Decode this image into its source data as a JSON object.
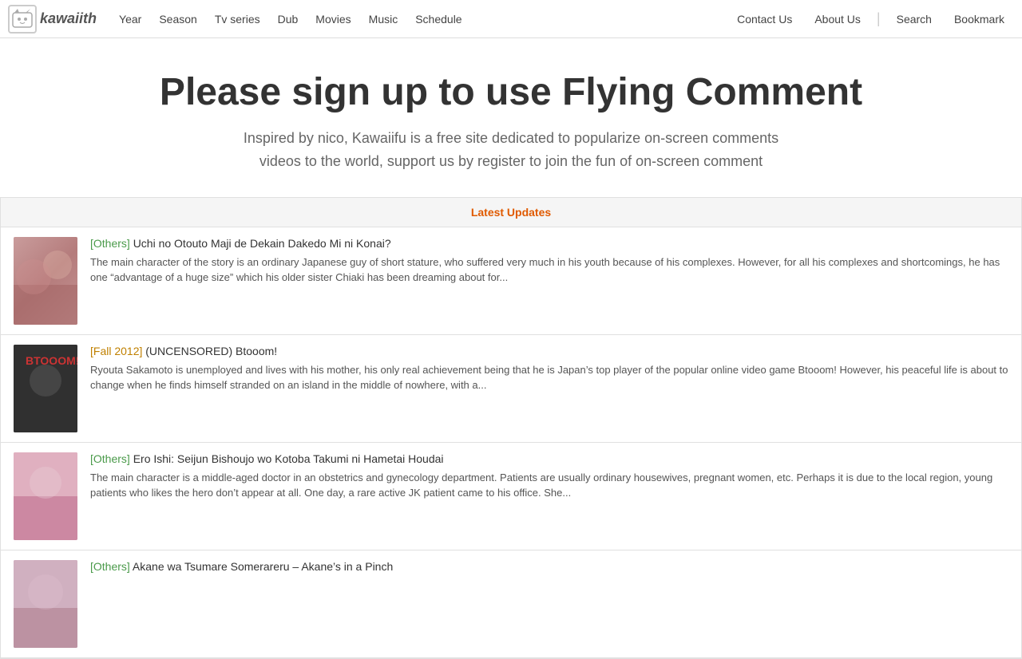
{
  "site": {
    "logo_emoji": "🐱",
    "logo_text": "kawaiith"
  },
  "navbar": {
    "links": [
      {
        "label": "Year",
        "id": "year"
      },
      {
        "label": "Season",
        "id": "season"
      },
      {
        "label": "Tv series",
        "id": "tv-series"
      },
      {
        "label": "Dub",
        "id": "dub"
      },
      {
        "label": "Movies",
        "id": "movies"
      },
      {
        "label": "Music",
        "id": "music"
      },
      {
        "label": "Schedule",
        "id": "schedule"
      }
    ],
    "right_links": [
      {
        "label": "Contact Us",
        "id": "contact"
      },
      {
        "label": "About Us",
        "id": "about"
      },
      {
        "label": "Search",
        "id": "search"
      },
      {
        "label": "Bookmark",
        "id": "bookmark"
      }
    ]
  },
  "hero": {
    "title": "Please sign up to use Flying Comment",
    "subtitle_line1": "Inspired by nico, Kawaiifu is a free site dedicated to popularize on-screen comments",
    "subtitle_line2": "videos to the world, support us by register to join the fun of on-screen comment"
  },
  "latest": {
    "header": "Latest Updates",
    "items": [
      {
        "tag": "[Others]",
        "tag_class": "tag",
        "title": "Uchi no Otouto Maji de Dekain Dakedo Mi ni Konai?",
        "description": "The main character of the story is an ordinary Japanese guy of short stature, who suffered very much in his youth because of his complexes. However, for all his complexes and shortcomings, he has one “advantage of a huge size” which his older sister Chiaki has been dreaming about for...",
        "thumb_class": "thumb-1"
      },
      {
        "tag": "[Fall 2012]",
        "tag_class": "tag tag-fall",
        "title": "(UNCENSORED) Btooom!",
        "description": "Ryouta Sakamoto is unemployed and lives with his mother, his only real achievement being that he is Japan’s top player of the popular online video game Btooom! However, his peaceful life is about to change when he finds himself stranded on an island in the middle of nowhere, with a...",
        "thumb_class": "thumb-2"
      },
      {
        "tag": "[Others]",
        "tag_class": "tag",
        "title": "Ero Ishi: Seijun Bishoujo wo Kotoba Takumi ni Hametai Houdai",
        "description": "The main character is a middle-aged doctor in an obstetrics and gynecology department. Patients  are usually ordinary housewives, pregnant women, etc. Perhaps it is due to the local region, young patients who likes the hero don’t appear at all. One day, a rare active JK patient came to his office. She...",
        "thumb_class": "thumb-3"
      },
      {
        "tag": "[Others]",
        "tag_class": "tag",
        "title": "Akane wa Tsumare Somerareru – Akane’s in a Pinch",
        "description": "",
        "thumb_class": "thumb-4"
      }
    ]
  }
}
